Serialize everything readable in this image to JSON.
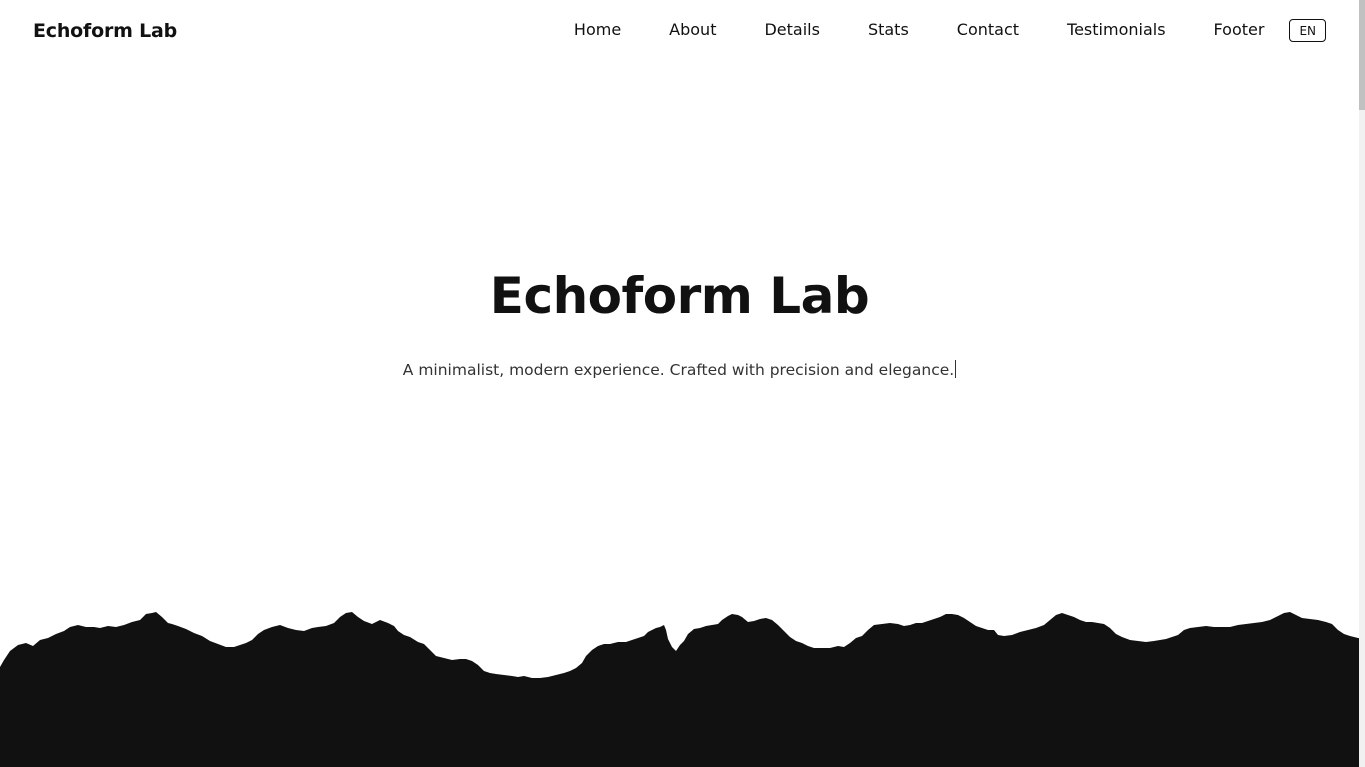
{
  "header": {
    "logo": "Echoform Lab",
    "nav": [
      {
        "label": "Home"
      },
      {
        "label": "About"
      },
      {
        "label": "Details"
      },
      {
        "label": "Stats"
      },
      {
        "label": "Contact"
      },
      {
        "label": "Testimonials"
      },
      {
        "label": "Footer"
      }
    ],
    "language": "EN"
  },
  "hero": {
    "title": "Echoform Lab",
    "subtitle": "A minimalist, modern experience. Crafted with precision and elegance."
  },
  "colors": {
    "background": "#ffffff",
    "text": "#111111",
    "torn_edge_fill": "#111111"
  }
}
